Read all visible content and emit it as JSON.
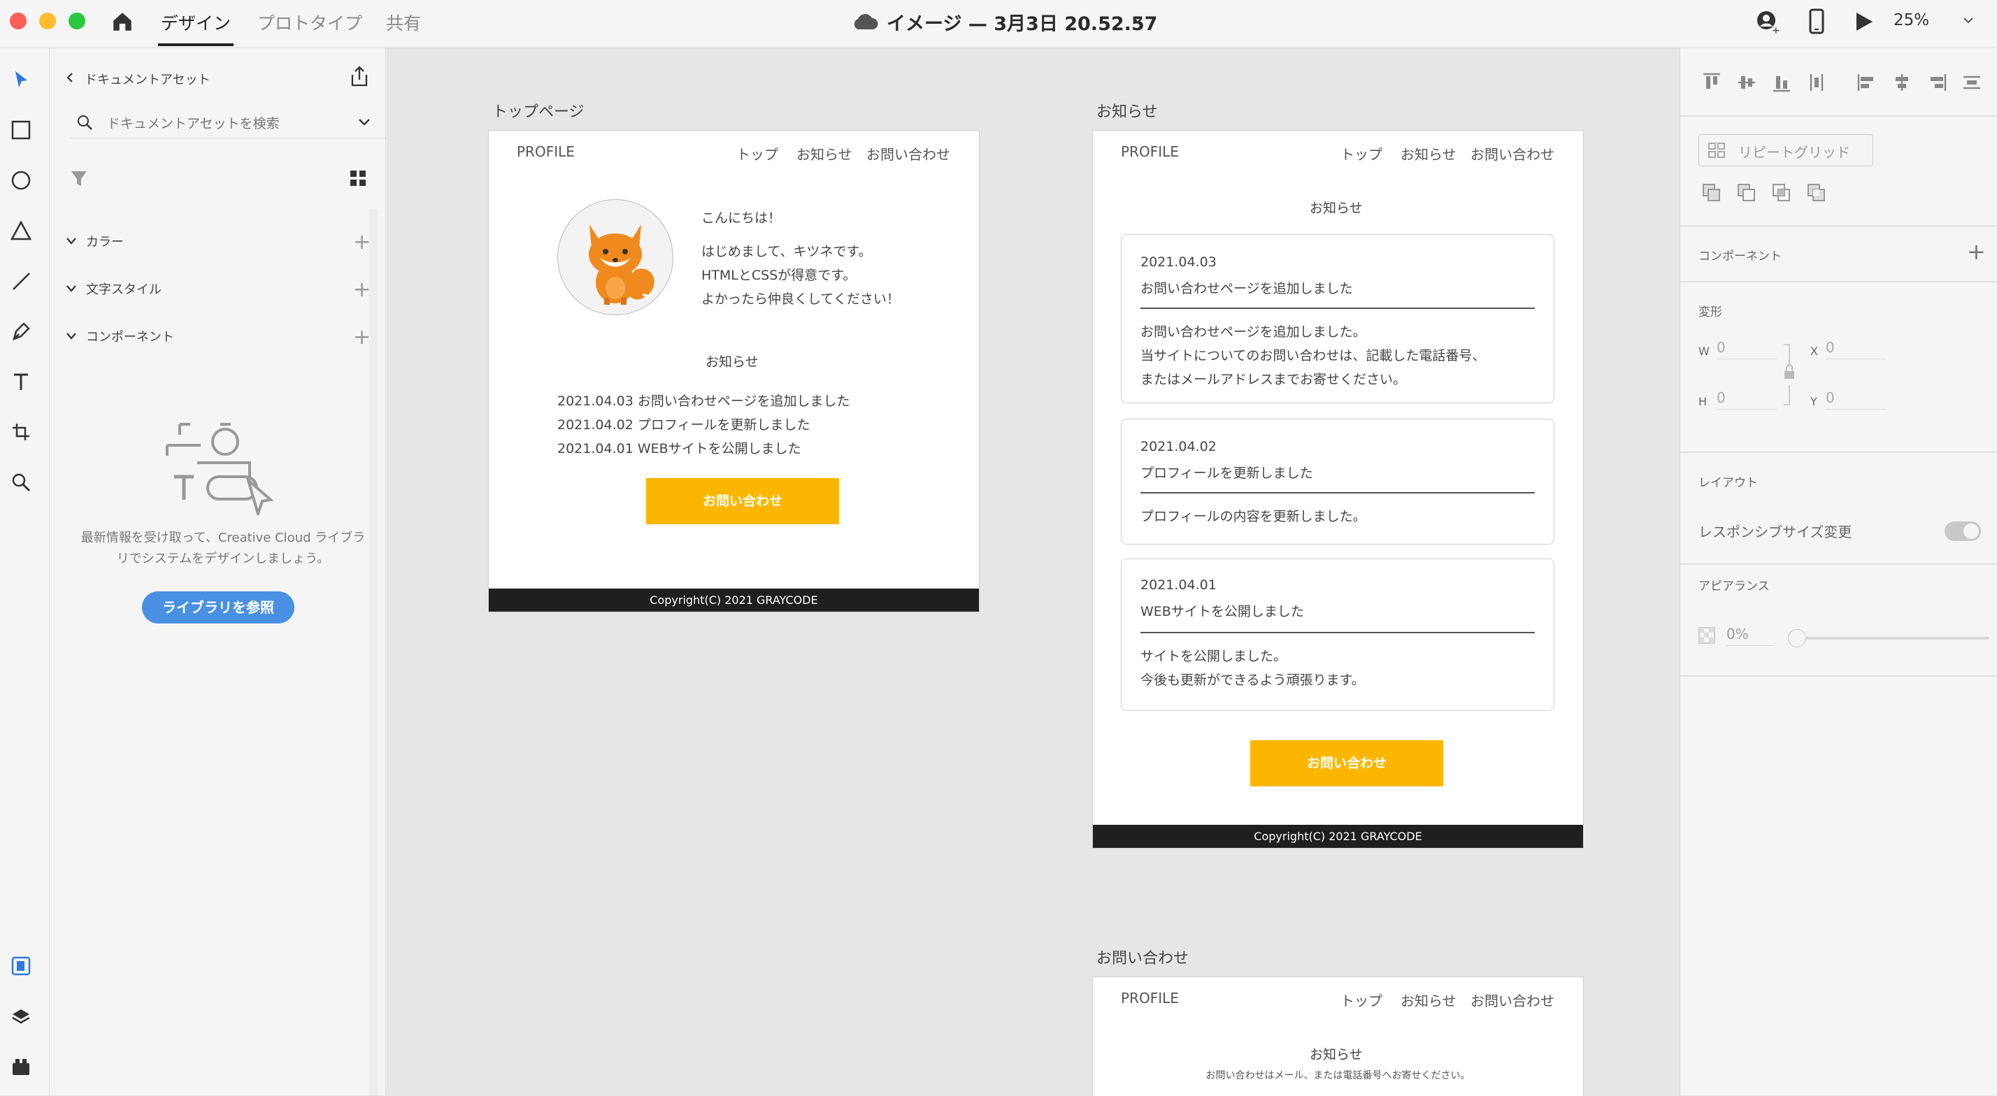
{
  "topbar": {
    "tabs": [
      "デザイン",
      "プロトタイプ",
      "共有"
    ],
    "doc_title": "イメージ — 3月3日 20.52.57",
    "zoom": "25%"
  },
  "assets": {
    "back_label": "ドキュメントアセット",
    "search_placeholder": "ドキュメントアセットを検索",
    "sections": [
      "カラー",
      "文字スタイル",
      "コンポーネント"
    ],
    "info_text": [
      "最新情報を受け取って、Creative Cloud ライブラ",
      "リでシステムをデザインしましょう。"
    ],
    "browse_button": "ライブラリを参照"
  },
  "props": {
    "repeat_grid": "リピートグリッド",
    "component_label": "コンポーネント",
    "transform_label": "変形",
    "w_label": "W",
    "w_value": "0",
    "x_label": "X",
    "x_value": "0",
    "h_label": "H",
    "h_value": "0",
    "y_label": "Y",
    "y_value": "0",
    "layout_label": "レイアウト",
    "responsive_label": "レスポンシブサイズ変更",
    "appearance_label": "アピアランス",
    "opacity_value": "0%"
  },
  "artboard_top": {
    "label": "トップページ",
    "logo": "PROFILE",
    "nav": [
      "トップ",
      "お知らせ",
      "お問い合わせ"
    ],
    "greeting": "こんにちは！",
    "intro": [
      "はじめまして、キツネです。",
      "HTMLとCSSが得意です。",
      "よかったら仲良くしてください！"
    ],
    "news_heading": "お知らせ",
    "news": [
      "2021.04.03 お問い合わせページを追加しました",
      "2021.04.02 プロフィールを更新しました",
      "2021.04.01 WEBサイトを公開しました"
    ],
    "cta": "お問い合わせ",
    "footer": "Copyright(C) 2021 GRAYCODE"
  },
  "artboard_news": {
    "label": "お知らせ",
    "logo": "PROFILE",
    "nav": [
      "トップ",
      "お知らせ",
      "お問い合わせ"
    ],
    "heading": "お知らせ",
    "cards": [
      {
        "date": "2021.04.03",
        "title": "お問い合わせページを追加しました",
        "body": [
          "お問い合わせページを追加しました。",
          "当サイトについてのお問い合わせは、記載した電話番号、",
          "またはメールアドレスまでお寄せください。"
        ]
      },
      {
        "date": "2021.04.02",
        "title": "プロフィールを更新しました",
        "body": [
          "プロフィールの内容を更新しました。"
        ]
      },
      {
        "date": "2021.04.01",
        "title": "WEBサイトを公開しました",
        "body": [
          "サイトを公開しました。",
          "今後も更新ができるよう頑張ります。"
        ]
      }
    ],
    "cta": "お問い合わせ",
    "footer": "Copyright(C) 2021 GRAYCODE"
  },
  "artboard_contact": {
    "label": "お問い合わせ",
    "logo": "PROFILE",
    "nav": [
      "トップ",
      "お知らせ",
      "お問い合わせ"
    ],
    "heading": "お知らせ",
    "subtext": "お問い合わせはメール、または電話番号へお寄せください。"
  },
  "colors": {
    "accent": "#fdb600",
    "footer": "#1f1f1f",
    "tool_active": "#2d7be5",
    "browse": "#4a90e2"
  }
}
